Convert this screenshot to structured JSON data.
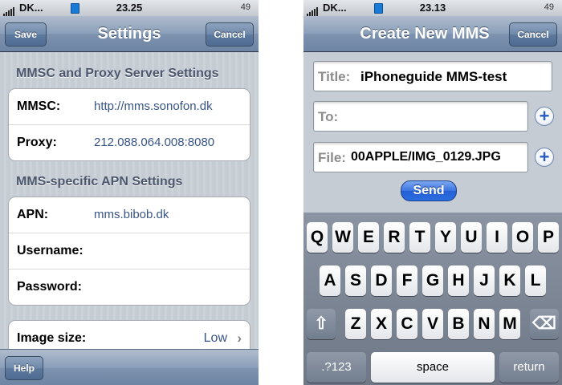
{
  "left_screen": {
    "status": {
      "carrier": "DK...",
      "time": "23.25",
      "battery": "49"
    },
    "nav": {
      "title": "Settings",
      "save_label": "Save",
      "cancel_label": "Cancel"
    },
    "section1": {
      "header": "MMSC and Proxy Server Settings",
      "rows": [
        {
          "label": "MMSC:",
          "value": "http://mms.sonofon.dk"
        },
        {
          "label": "Proxy:",
          "value": "212.088.064.008:8080"
        }
      ]
    },
    "section2": {
      "header": "MMS-specific APN Settings",
      "rows": [
        {
          "label": "APN:",
          "value": "mms.bibob.dk"
        },
        {
          "label": "Username:",
          "value": ""
        },
        {
          "label": "Password:",
          "value": ""
        }
      ]
    },
    "image_size": {
      "label": "Image size:",
      "value": "Low"
    },
    "toolbar": {
      "help_label": "Help"
    }
  },
  "right_screen": {
    "status": {
      "carrier": "DK...",
      "time": "23.13",
      "battery": "49"
    },
    "nav": {
      "title": "Create New MMS",
      "cancel_label": "Cancel"
    },
    "title_field": {
      "label": "Title:",
      "value": "iPhoneguide MMS-test"
    },
    "to_field": {
      "label": "To:",
      "value": ""
    },
    "file_field": {
      "label": "File:",
      "value": "00APPLE/IMG_0129.JPG"
    },
    "send_label": "Send",
    "keyboard": {
      "row1": [
        "Q",
        "W",
        "E",
        "R",
        "T",
        "Y",
        "U",
        "I",
        "O",
        "P"
      ],
      "row2": [
        "A",
        "S",
        "D",
        "F",
        "G",
        "H",
        "J",
        "K",
        "L"
      ],
      "row3": [
        "Z",
        "X",
        "C",
        "V",
        "B",
        "N",
        "M"
      ],
      "numbers_label": ".?123",
      "space_label": "space",
      "return_label": "return"
    }
  },
  "colors": {
    "nav_blue": "#7d93b0",
    "value_blue": "#385487",
    "send_blue": "#2a6de0"
  }
}
